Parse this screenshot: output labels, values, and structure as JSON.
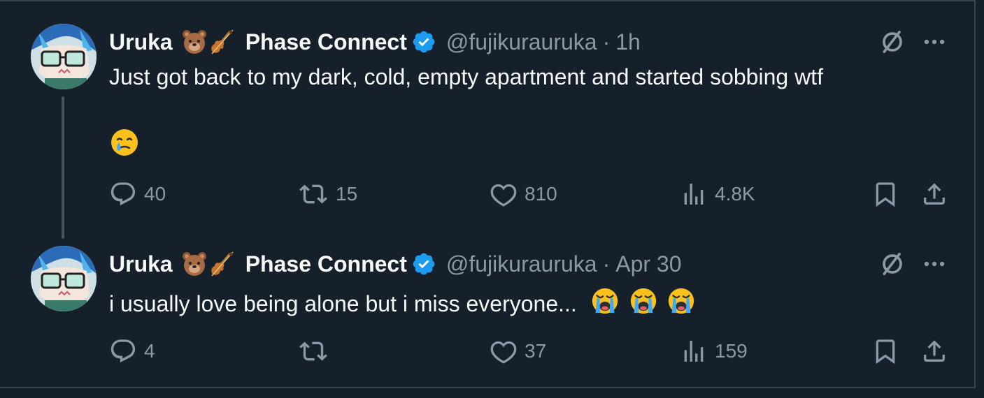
{
  "colors": {
    "background": "#15202b",
    "border": "#38444d",
    "text_primary": "#f7f9f9",
    "text_secondary": "#8b98a5",
    "verified_blue": "#1d9bf0"
  },
  "tweets": [
    {
      "display_name": "Uruka",
      "org_name": "Phase Connect",
      "handle": "@fujikurauruka",
      "separator": "·",
      "time": "1h",
      "text": "Just got back to my dark, cold, empty apartment and started sobbing wtf",
      "trailing_emoji": "face-holding-back-tears-emoji",
      "actions": {
        "replies": "40",
        "reposts": "15",
        "likes": "810",
        "views": "4.8K"
      }
    },
    {
      "display_name": "Uruka",
      "org_name": "Phase Connect",
      "handle": "@fujikurauruka",
      "separator": "·",
      "time": "Apr 30",
      "text": "i usually love being alone but i miss everyone...",
      "trailing_emoji": "loudly-crying-face-emoji",
      "actions": {
        "replies": "4",
        "reposts": "",
        "likes": "37",
        "views": "159"
      }
    }
  ]
}
